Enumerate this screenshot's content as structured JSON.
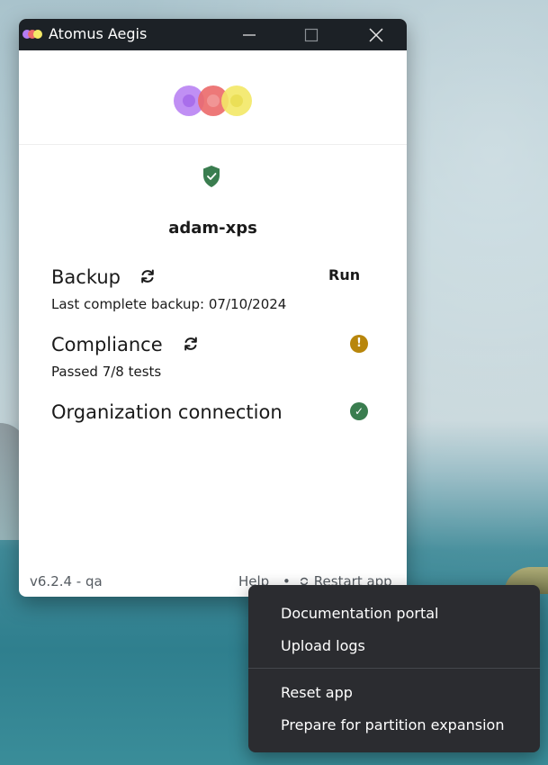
{
  "window": {
    "title": "Atomus Aegis",
    "controls": {
      "minimize": "—",
      "maximize": "☐",
      "close": "✕"
    }
  },
  "device": {
    "name": "adam-xps"
  },
  "backup": {
    "title": "Backup",
    "subtitle": "Last complete backup: 07/10/2024",
    "action_label": "Run"
  },
  "compliance": {
    "title": "Compliance",
    "subtitle": "Passed 7/8 tests",
    "status_glyph": "!"
  },
  "organization": {
    "title": "Organization connection",
    "status_glyph": "✓"
  },
  "footer": {
    "version": "v6.2.4 - qa",
    "help": "Help",
    "separator": "•",
    "restart": "Restart app"
  },
  "context_menu": {
    "items": [
      "Documentation portal",
      "Upload logs",
      "Reset app",
      "Prepare for partition expansion"
    ]
  },
  "colors": {
    "titlebar": "#1c2126",
    "success": "#3a7d4f",
    "warning": "#b8860b",
    "logo_purple": "#b57cf2",
    "logo_red": "#ec6a6a",
    "logo_yellow": "#f3e867",
    "menu_bg": "#2b2c30"
  },
  "icons": {
    "app": "atomus-logo-icon",
    "sync": "sync-icon",
    "shield": "shield-check-icon",
    "warning": "warning-icon",
    "check": "check-circle-icon"
  }
}
